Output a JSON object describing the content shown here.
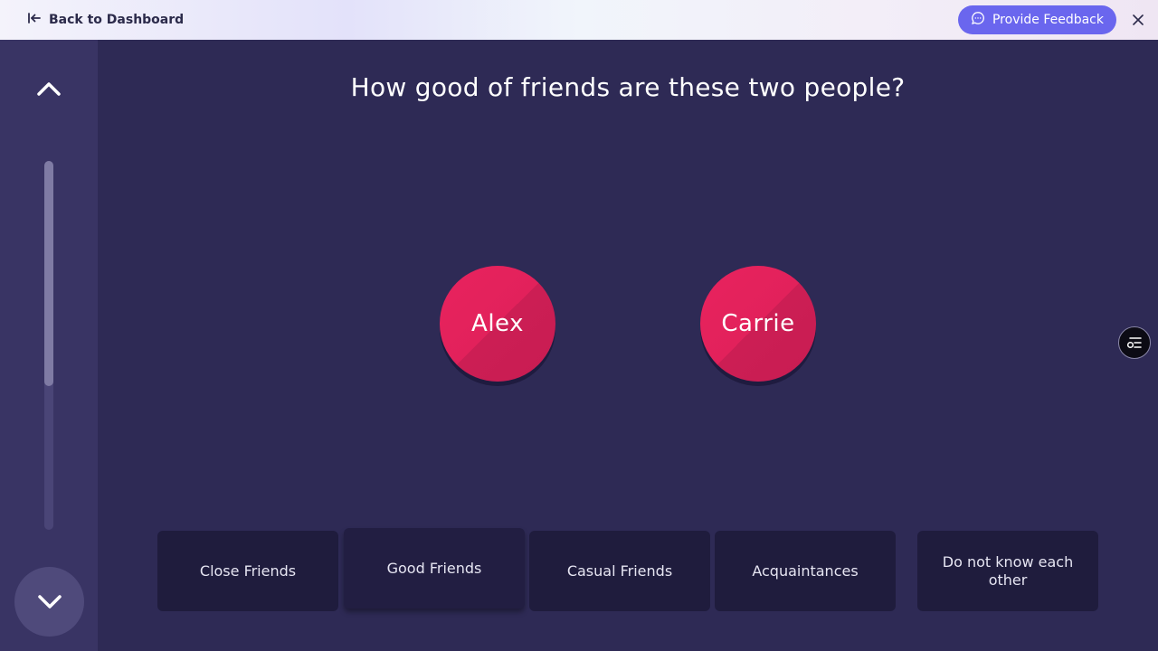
{
  "header": {
    "back_label": "Back to Dashboard",
    "feedback_label": "Provide Feedback"
  },
  "sidebar": {
    "progress_fraction": 0.61
  },
  "question": "How good of friends are these two people?",
  "people": [
    "Alex",
    "Carrie"
  ],
  "answers": [
    "Close Friends",
    "Good Friends",
    "Casual Friends",
    "Acquaintances",
    "Do not know each other"
  ],
  "colors": {
    "accent": "#6a66ee",
    "person_bubble": "#e2215b",
    "background": "#2e2a55"
  }
}
